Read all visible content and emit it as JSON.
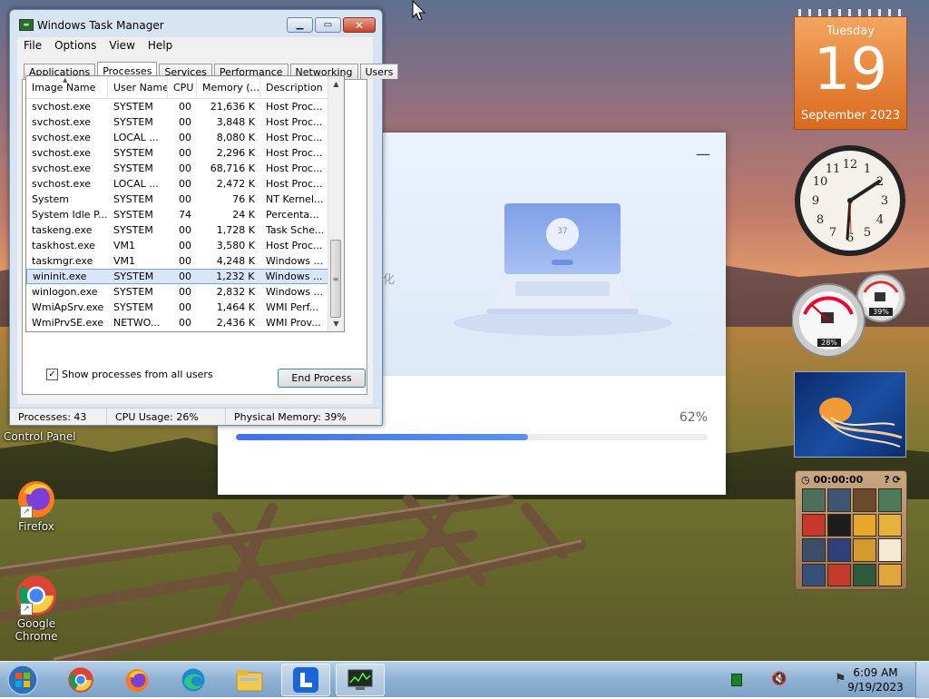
{
  "task_manager": {
    "title": "Windows Task Manager",
    "menu": [
      "File",
      "Options",
      "View",
      "Help"
    ],
    "tabs": [
      "Applications",
      "Processes",
      "Services",
      "Performance",
      "Networking",
      "Users"
    ],
    "active_tab": "Processes",
    "columns": [
      "Image Name",
      "User Name",
      "CPU",
      "Memory (...",
      "Description"
    ],
    "rows": [
      [
        "svchost.exe",
        "SYSTEM",
        "00",
        "21,636 K",
        "Host Proc..."
      ],
      [
        "svchost.exe",
        "SYSTEM",
        "00",
        "3,848 K",
        "Host Proc..."
      ],
      [
        "svchost.exe",
        "LOCAL ...",
        "00",
        "8,080 K",
        "Host Proc..."
      ],
      [
        "svchost.exe",
        "SYSTEM",
        "00",
        "2,296 K",
        "Host Proc..."
      ],
      [
        "svchost.exe",
        "SYSTEM",
        "00",
        "68,716 K",
        "Host Proc..."
      ],
      [
        "svchost.exe",
        "LOCAL ...",
        "00",
        "2,472 K",
        "Host Proc..."
      ],
      [
        "System",
        "SYSTEM",
        "00",
        "76 K",
        "NT Kernel..."
      ],
      [
        "System Idle P...",
        "SYSTEM",
        "74",
        "24 K",
        "Percenta..."
      ],
      [
        "taskeng.exe",
        "SYSTEM",
        "00",
        "1,728 K",
        "Task Sche..."
      ],
      [
        "taskhost.exe",
        "VM1",
        "00",
        "3,580 K",
        "Host Proc..."
      ],
      [
        "taskmgr.exe",
        "VM1",
        "00",
        "4,248 K",
        "Windows ..."
      ],
      [
        "wininit.exe",
        "SYSTEM",
        "00",
        "1,232 K",
        "Windows ..."
      ],
      [
        "winlogon.exe",
        "SYSTEM",
        "00",
        "2,832 K",
        "Windows ..."
      ],
      [
        "WmiApSrv.exe",
        "SYSTEM",
        "00",
        "1,464 K",
        "WMI Perf..."
      ],
      [
        "WmiPrvSE.exe",
        "NETWO...",
        "00",
        "2,436 K",
        "WMI Prov..."
      ]
    ],
    "selected_row": 11,
    "show_all_users_label": "Show processes from all users",
    "show_all_users_checked": true,
    "end_process_label": "End Process",
    "status": {
      "processes": "Processes: 43",
      "cpu": "CPU Usage: 26%",
      "memory": "Physical Memory: 39%"
    }
  },
  "installer": {
    "progress_percent_text": "62%",
    "progress_fraction": 0.62,
    "hint_text": "化",
    "screen_badge": "37"
  },
  "desktop_icons": {
    "control_panel": "Control Panel",
    "firefox": "Firefox",
    "chrome_line1": "Google",
    "chrome_line2": "Chrome"
  },
  "gadgets": {
    "calendar_day": "Tuesday",
    "calendar_date": "19",
    "calendar_month": "September 2023",
    "meter_cpu": "28%",
    "meter_mem": "39%",
    "puzzle_timer": "00:00:00"
  },
  "taskbar": {
    "time": "6:09 AM",
    "date": "9/19/2023"
  },
  "colors": {
    "accent": "#3e74e3",
    "calendar": "#e9822f",
    "taskbar": "#8fb2d3"
  }
}
